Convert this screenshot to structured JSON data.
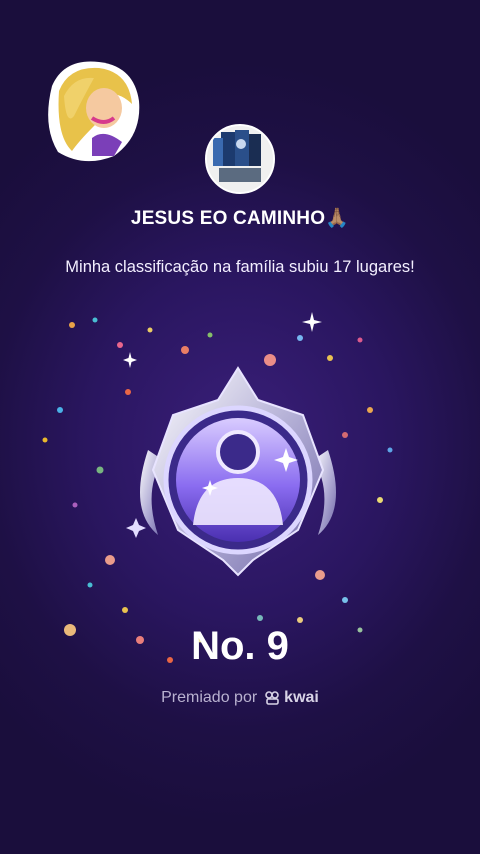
{
  "header": {
    "family_name": "JESUS EO CAMINHO🙏🏽",
    "message": "Minha classificação na família subiu 17 lugares!"
  },
  "badge": {
    "rank_label": "No. 9"
  },
  "footer": {
    "awarded_by": "Premiado por",
    "brand": "kwai"
  },
  "colors": {
    "background": "#1e1045",
    "badge_accent": "#8a6cf0"
  }
}
